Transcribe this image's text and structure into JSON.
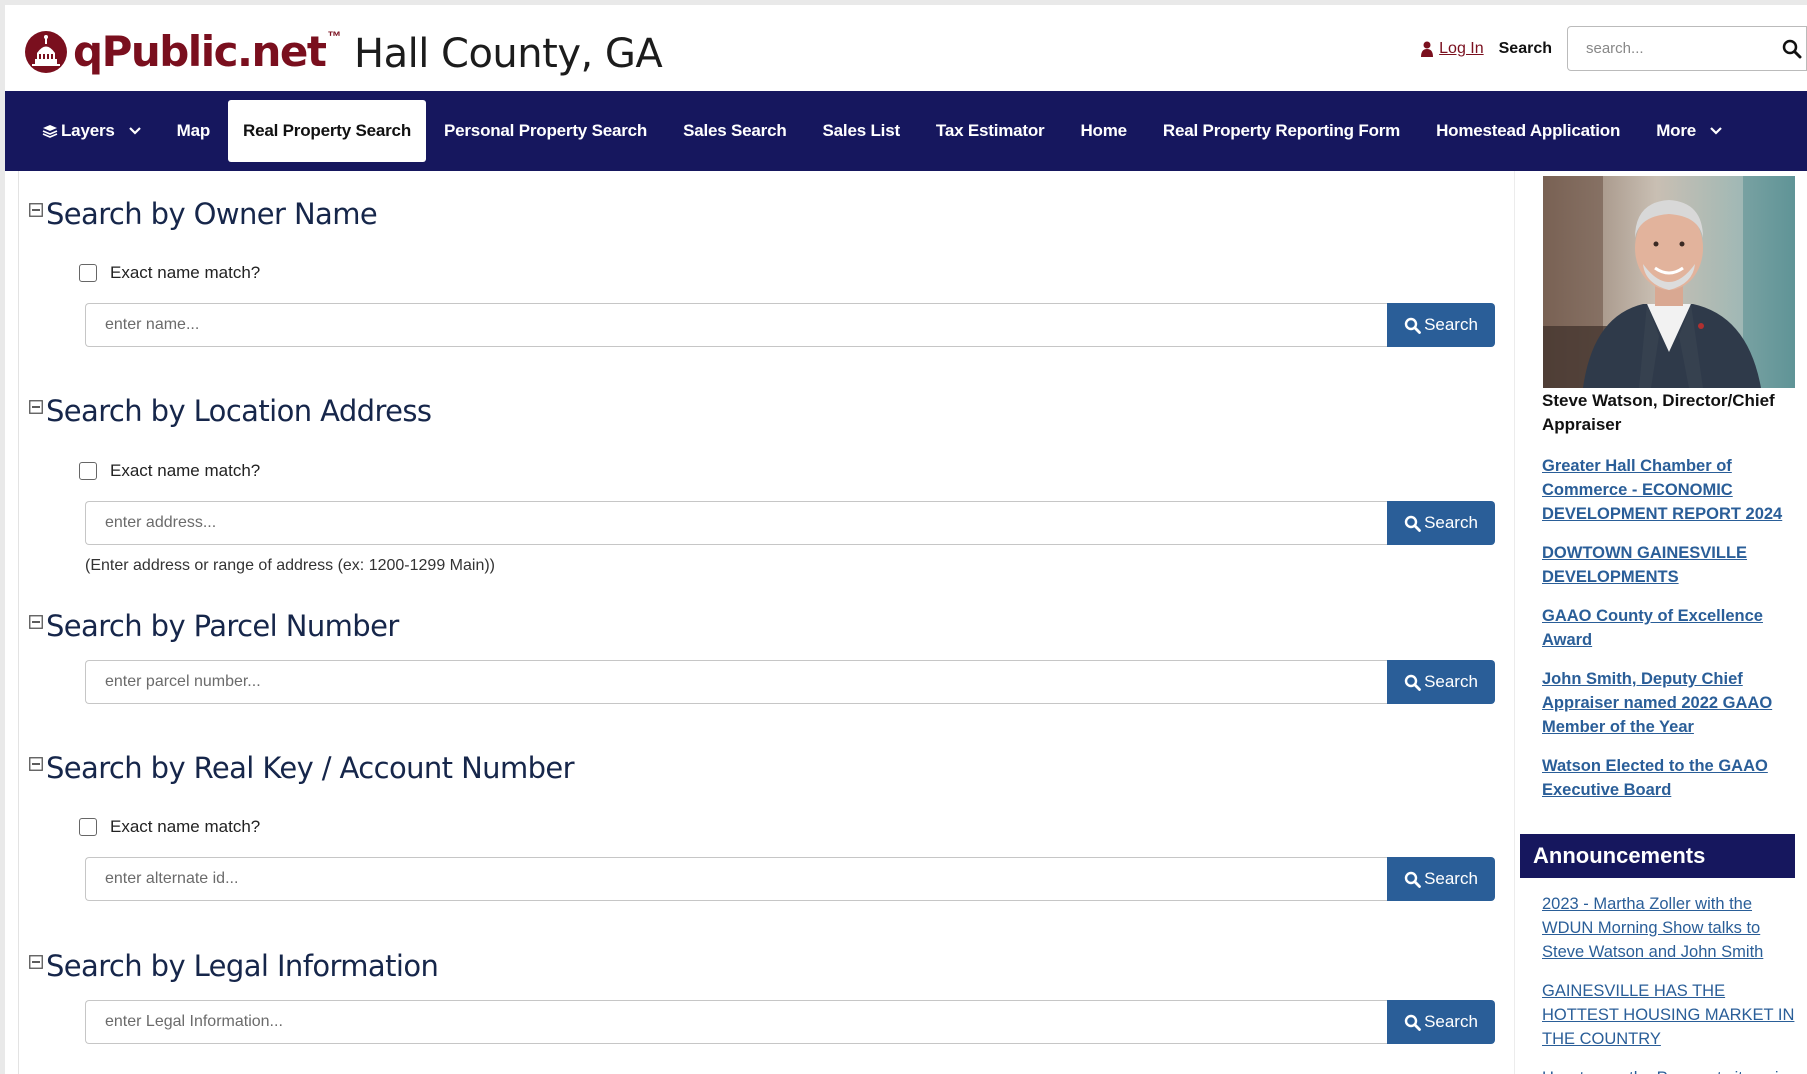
{
  "header": {
    "brand": "qPublic.net",
    "tm": "™",
    "county": "Hall County, GA",
    "login_label": "Log In",
    "search_label": "Search",
    "search_placeholder": "search..."
  },
  "nav": {
    "items": [
      {
        "label": "Layers"
      },
      {
        "label": "Map"
      },
      {
        "label": "Real Property Search"
      },
      {
        "label": "Personal Property Search"
      },
      {
        "label": "Sales Search"
      },
      {
        "label": "Sales List"
      },
      {
        "label": "Tax Estimator"
      },
      {
        "label": "Home"
      },
      {
        "label": "Real Property Reporting Form"
      },
      {
        "label": "Homestead Application"
      },
      {
        "label": "More"
      }
    ],
    "active_index": 2
  },
  "sections": [
    {
      "title": "Search by Owner Name",
      "checkbox_label": "Exact name match?",
      "placeholder": "enter name...",
      "button": "Search"
    },
    {
      "title": "Search by Location Address",
      "checkbox_label": "Exact name match?",
      "placeholder": "enter address...",
      "button": "Search",
      "hint": "(Enter address or range of address (ex: 1200-1299 Main))"
    },
    {
      "title": "Search by Parcel Number",
      "placeholder": "enter parcel number...",
      "button": "Search"
    },
    {
      "title": "Search by Real Key / Account Number",
      "checkbox_label": "Exact name match?",
      "placeholder": "enter alternate id...",
      "button": "Search"
    },
    {
      "title": "Search by Legal Information",
      "placeholder": "enter Legal Information...",
      "button": "Search"
    }
  ],
  "sidebar": {
    "caption": "Steve Watson, Director/Chief Appraiser",
    "links": [
      "Greater Hall Chamber of Commerce - ECONOMIC DEVELOPMENT REPORT 2024",
      "DOWTOWN GAINESVILLE DEVELOPMENTS",
      "GAAO County of Excellence Award",
      "John Smith, Deputy Chief Appraiser named 2022 GAAO Member of the Year",
      "Watson Elected to the GAAO Executive Board"
    ],
    "announcements_title": "Announcements",
    "announcements": [
      "2023 - Martha Zoller with the WDUN Morning Show talks to Steve Watson and John Smith",
      "GAINESVILLE HAS THE HOTTEST HOUSING MARKET IN THE COUNTRY",
      "How to use the Passport site - view"
    ]
  },
  "colors": {
    "nav_bg": "#16175e",
    "brand": "#7a0f1e",
    "button": "#2a5e98",
    "title": "#16264a"
  }
}
